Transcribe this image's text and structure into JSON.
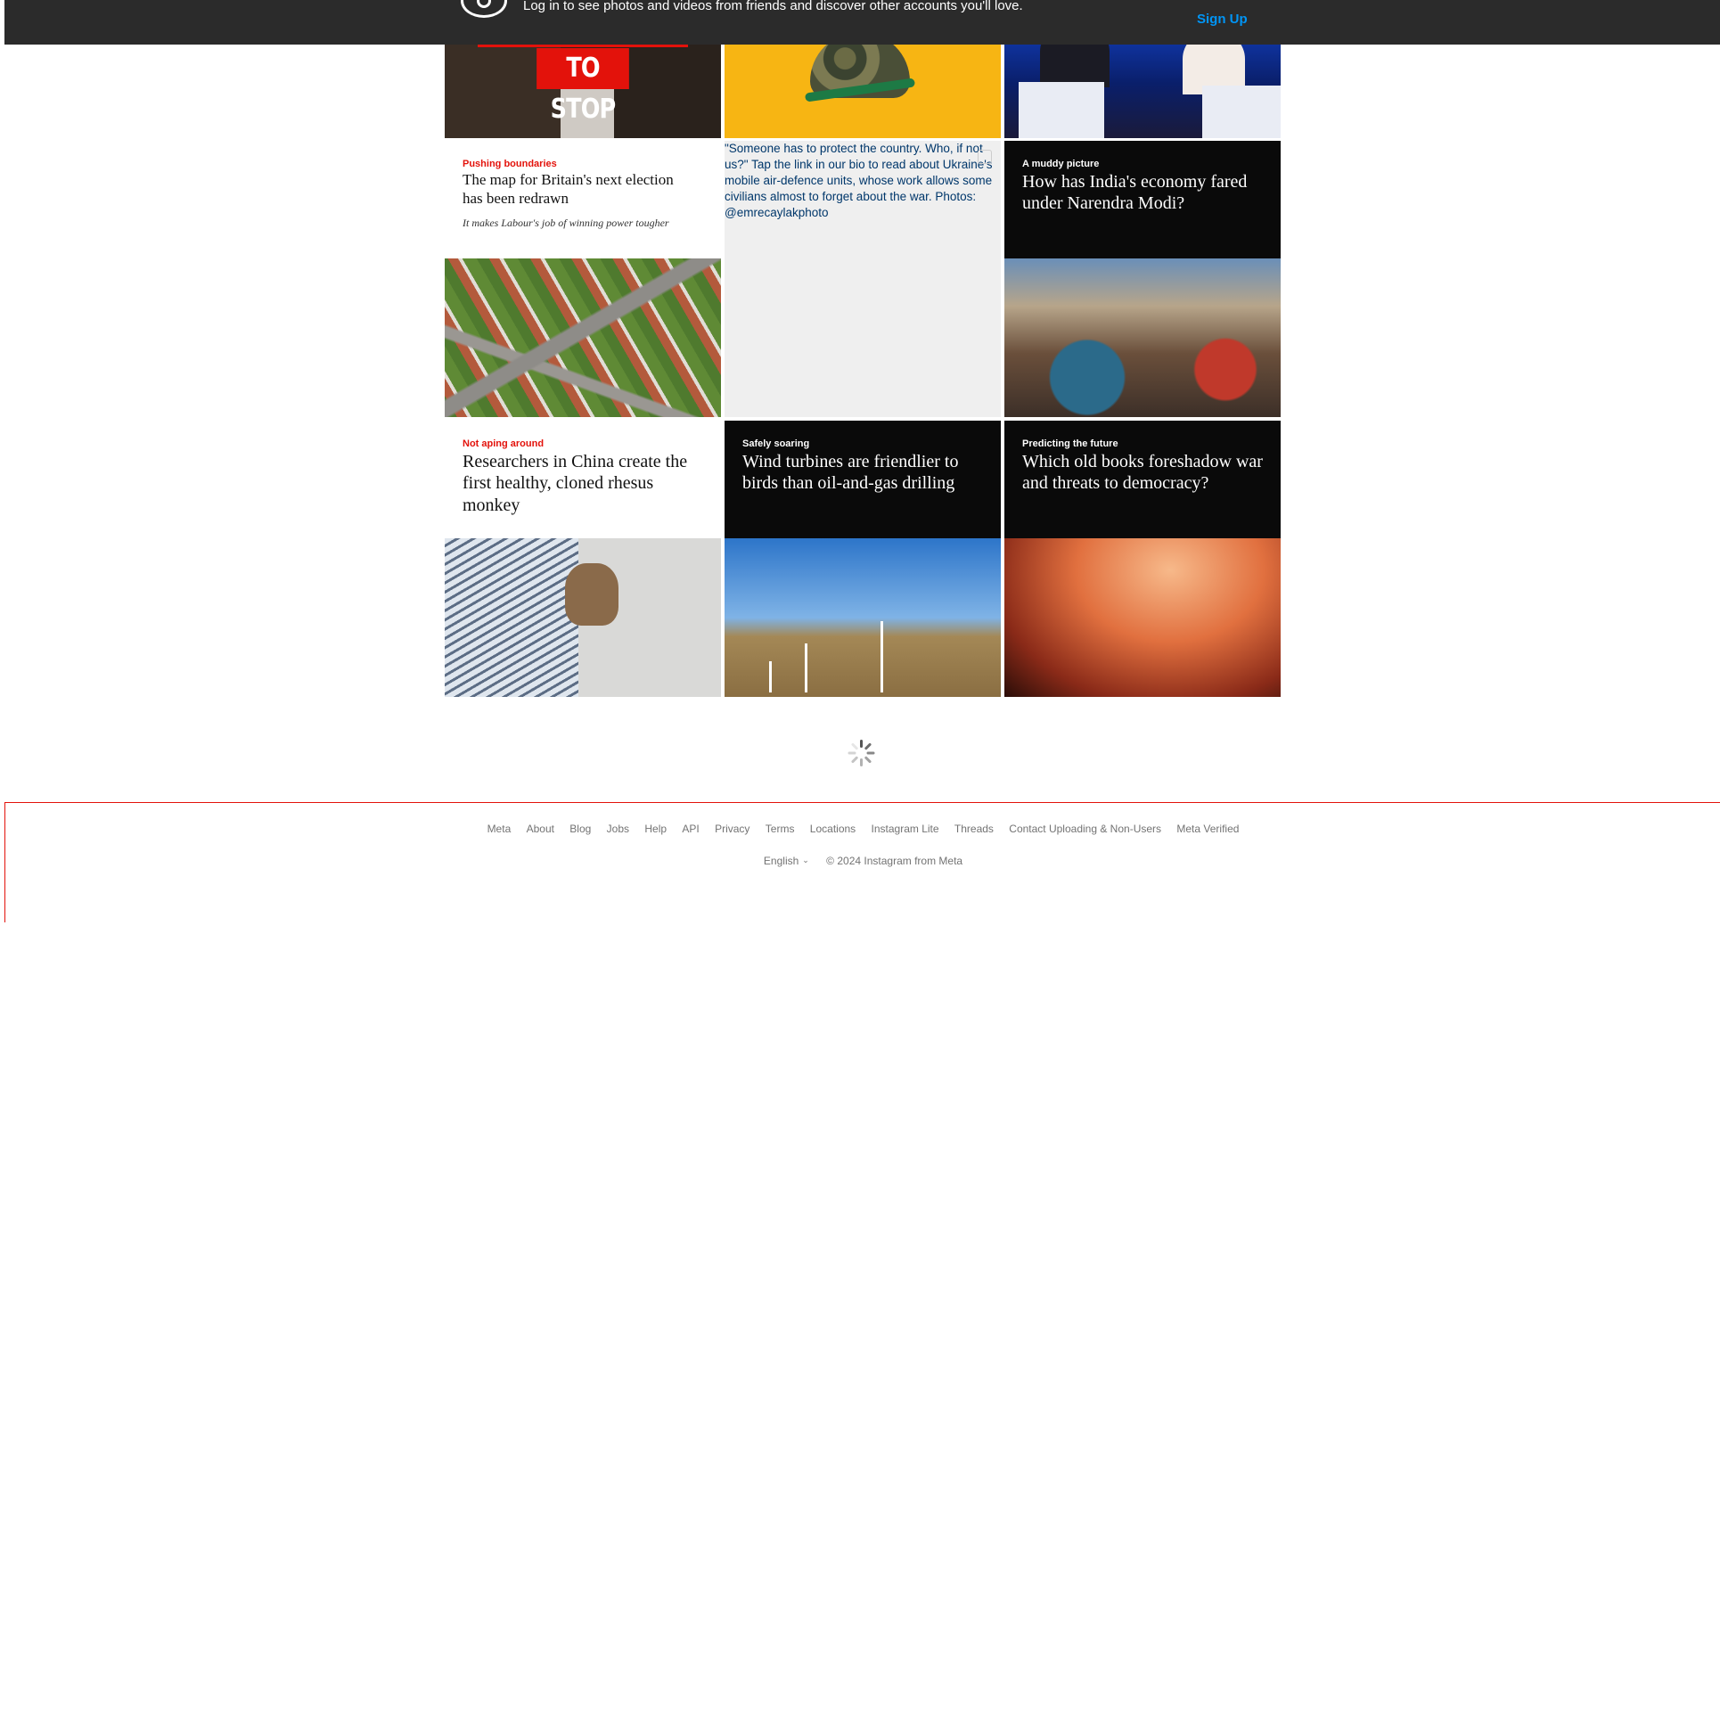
{
  "banner": {
    "message": "Log in to see photos and videos from friends and discover other accounts you'll love.",
    "signup_label": "Sign Up"
  },
  "grid": {
    "tile1": {
      "image_text": "TO STOP AI"
    },
    "tile4": {
      "kicker": "Pushing boundaries",
      "headline": "The map for Britain's next election has been redrawn",
      "sub": "It makes Labour's job of winning power tougher"
    },
    "tile5": {
      "alt_text": "\"Someone has to protect the country. Who, if not us?\"  Tap the link in our bio to read about Ukraine's mobile air-defence units, whose work allows some civilians almost to forget about the war.   Photos: @emrecaylakphoto"
    },
    "tile6": {
      "kicker": "A muddy picture",
      "headline": "How has India's economy fared under Narendra Modi?"
    },
    "tile7": {
      "kicker": "Not aping around",
      "headline": "Researchers in China create the first healthy, cloned rhesus monkey"
    },
    "tile8": {
      "kicker": "Safely soaring",
      "headline": "Wind turbines are friendlier to birds than oil-and-gas drilling"
    },
    "tile9": {
      "kicker": "Predicting the future",
      "headline": "Which old books foreshadow war and threats to democracy?"
    }
  },
  "footer": {
    "links": [
      "Meta",
      "About",
      "Blog",
      "Jobs",
      "Help",
      "API",
      "Privacy",
      "Terms",
      "Locations",
      "Instagram Lite",
      "Threads",
      "Contact Uploading & Non-Users",
      "Meta Verified"
    ],
    "language": "English",
    "copyright": "© 2024 Instagram from Meta"
  },
  "colors": {
    "banner_bg": "#2b2b2b",
    "signup": "#0095f6",
    "economist_red": "#e3120b",
    "link_text": "#737373"
  },
  "icons": [
    "instagram-logo-icon",
    "loading-spinner-icon",
    "chevron-down-icon"
  ]
}
